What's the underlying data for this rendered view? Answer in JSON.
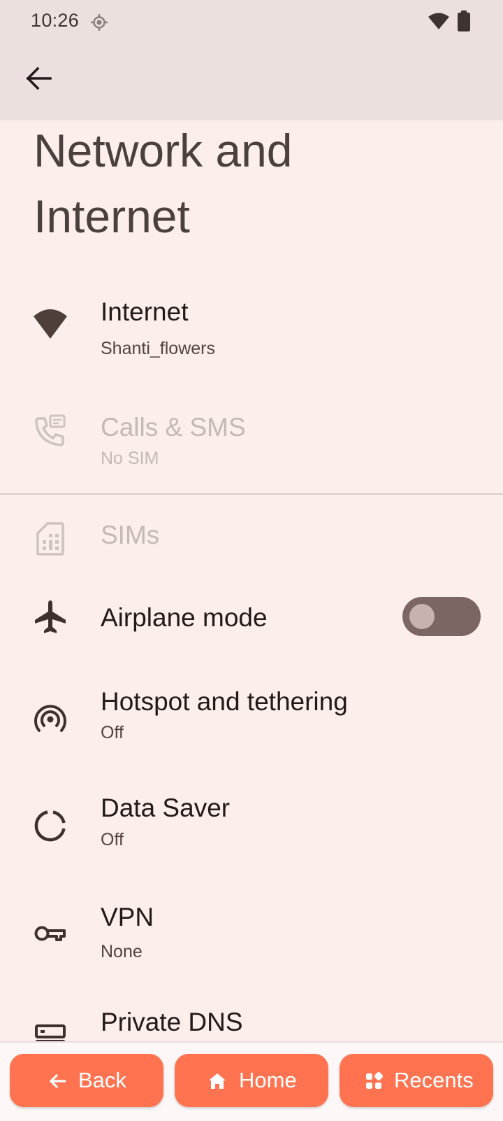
{
  "status_bar": {
    "time": "10:26",
    "icons": [
      "location-icon",
      "wifi-icon",
      "battery-icon"
    ]
  },
  "app_bar": {
    "back_icon": "arrow-back-icon"
  },
  "page": {
    "title": "Network and Internet"
  },
  "items": {
    "internet": {
      "title": "Internet",
      "summary": "Shanti_flowers",
      "icon": "wifi-icon"
    },
    "calls_sms": {
      "title": "Calls & SMS",
      "summary": "No SIM",
      "icon": "phone-forward-icon",
      "enabled": false
    },
    "sims": {
      "title": "SIMs",
      "icon": "sim-card-icon",
      "enabled": false
    },
    "airplane": {
      "title": "Airplane mode",
      "icon": "airplane-icon",
      "toggle_on": false
    },
    "hotspot": {
      "title": "Hotspot and tethering",
      "summary": "Off",
      "icon": "hotspot-icon"
    },
    "data_saver": {
      "title": "Data Saver",
      "summary": "Off",
      "icon": "data-saver-icon"
    },
    "vpn": {
      "title": "VPN",
      "summary": "None",
      "icon": "key-icon"
    },
    "private_dns": {
      "title": "Private DNS",
      "icon": "dns-icon"
    }
  },
  "nav_bar": {
    "back": "Back",
    "home": "Home",
    "recents": "Recents"
  },
  "colors": {
    "background": "#fbeeeb",
    "app_bar": "#ebe0de",
    "accent_button": "#ff7350",
    "toggle_track": "#7c6663"
  }
}
